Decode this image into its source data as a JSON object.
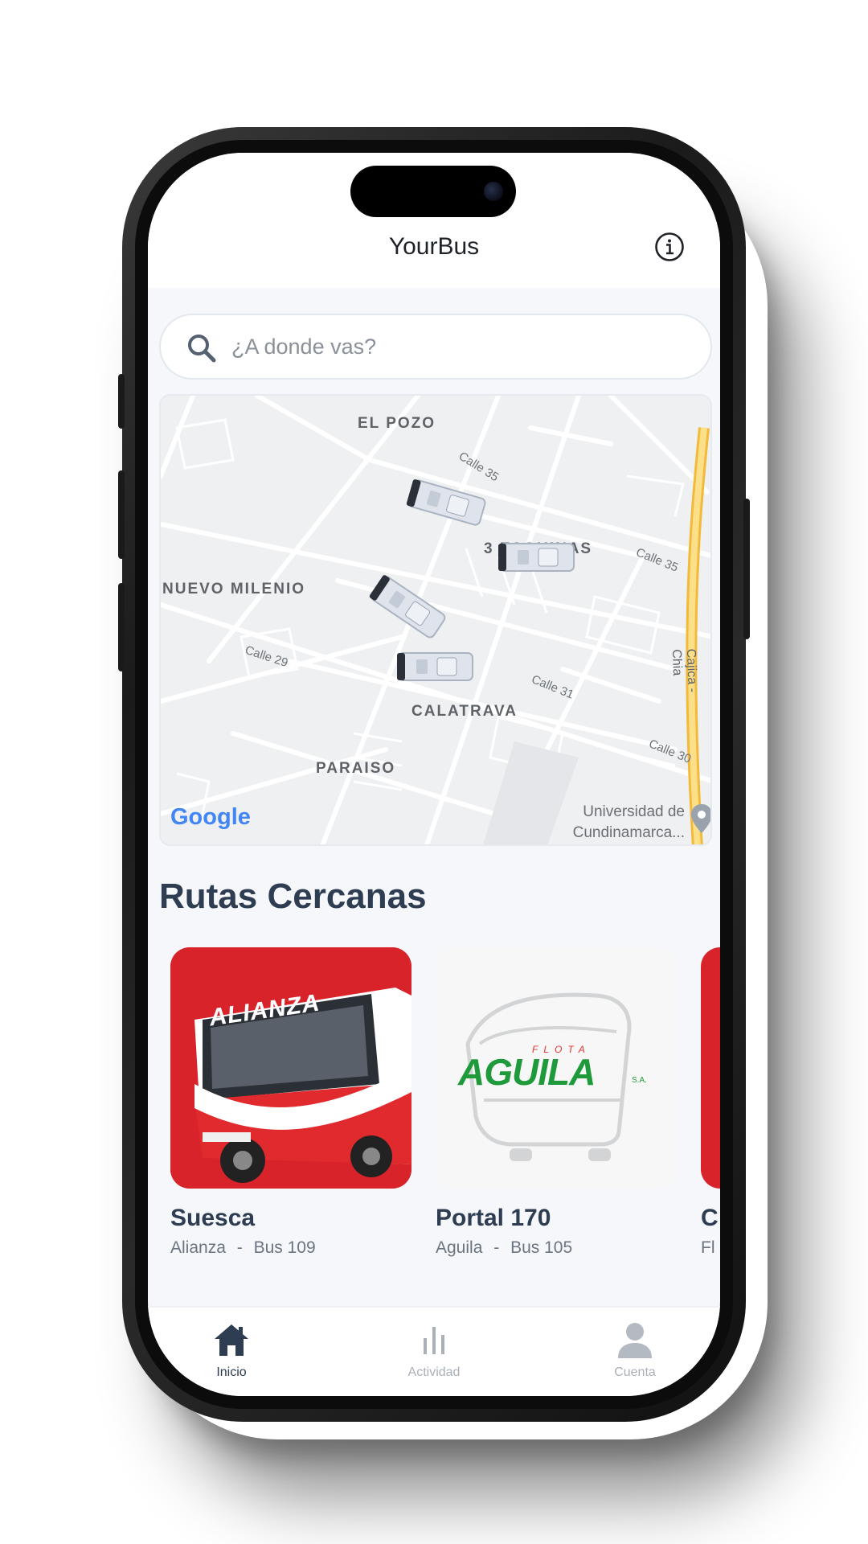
{
  "app": {
    "title": "YourBus"
  },
  "search": {
    "placeholder": "¿A donde vas?"
  },
  "map": {
    "neighborhoods": [
      "EL POZO",
      "3 ESQUINAS",
      "NUEVO MILENIO",
      "CALATRAVA",
      "PARAISO"
    ],
    "streets": [
      "Calle 35",
      "Calle 35",
      "Calle 29",
      "Calle 31",
      "Calle 30",
      "Cajica - Chia"
    ],
    "poi": [
      "Universidad de",
      "Cundinamarca..."
    ],
    "attribution": "Google",
    "bus_markers": 4
  },
  "nearby": {
    "title": "Rutas Cercanas",
    "routes": [
      {
        "name": "Suesca",
        "company": "Alianza",
        "bus": "Bus 109",
        "sep": "-",
        "logo_text": "ALIANZA"
      },
      {
        "name": "Portal 170",
        "company": "Aguila",
        "bus": "Bus 105",
        "sep": "-",
        "logo_text": "AGUILA",
        "logo_sub": "FLOTA",
        "logo_sa": "S.A."
      },
      {
        "name": "C",
        "company": "Fl",
        "bus": "",
        "sep": "",
        "logo_text": ""
      }
    ]
  },
  "tabs": [
    {
      "label": "Inicio",
      "icon": "home-icon",
      "active": true
    },
    {
      "label": "Actividad",
      "icon": "bar-chart-icon",
      "active": false
    },
    {
      "label": "Cuenta",
      "icon": "user-icon",
      "active": false
    }
  ],
  "colors": {
    "accent": "#2e3d52",
    "active_tab": "#2e3d52",
    "inactive_tab": "#a9b0b8",
    "alianza_red": "#d8232a",
    "aguila_green": "#1e9a3a",
    "aguila_red": "#e3342f"
  }
}
